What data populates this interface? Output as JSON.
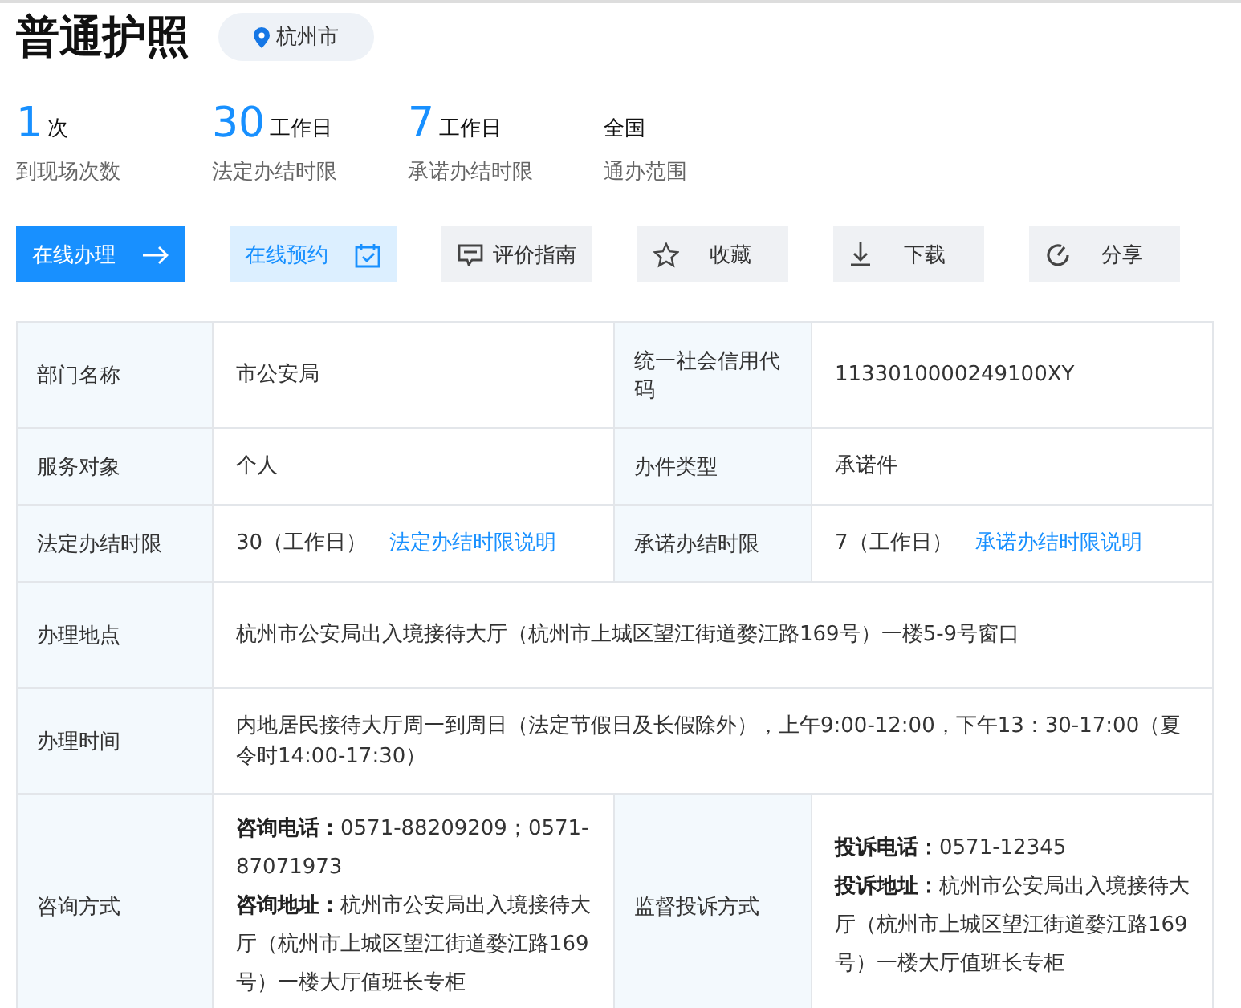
{
  "title": "普通护照",
  "location": "杭州市",
  "stats": [
    {
      "value": "1",
      "unit": "次",
      "label": "到现场次数"
    },
    {
      "value": "30",
      "unit": "工作日",
      "label": "法定办结时限"
    },
    {
      "value": "7",
      "unit": "工作日",
      "label": "承诺办结时限"
    },
    {
      "unit": "全国",
      "label": "通办范围"
    }
  ],
  "actions": [
    {
      "kind": "primary",
      "label": "在线办理"
    },
    {
      "kind": "light",
      "label": "在线预约"
    },
    {
      "kind": "gray",
      "label": "评价指南"
    },
    {
      "kind": "gray",
      "label": "收藏"
    },
    {
      "kind": "gray",
      "label": "下载"
    },
    {
      "kind": "gray",
      "label": "分享"
    }
  ],
  "rows": [
    {
      "cells": [
        {
          "label": "部门名称",
          "value": "市公安局"
        },
        {
          "label": "统一社会信用代码",
          "value": "1133010000249100XY"
        }
      ]
    },
    {
      "cells": [
        {
          "label": "服务对象",
          "value": "个人"
        },
        {
          "label": "办件类型",
          "value": "承诺件"
        }
      ]
    },
    {
      "cells": [
        {
          "label": "法定办结时限",
          "value": "30（工作日）",
          "link": "法定办结时限说明"
        },
        {
          "label": "承诺办结时限",
          "value": "7（工作日）",
          "link": "承诺办结时限说明"
        }
      ]
    },
    {
      "cells": [
        {
          "label": "办理地点",
          "value": "杭州市公安局出入境接待大厅（杭州市上城区望江街道婺江路169号）一楼5-9号窗口"
        }
      ]
    },
    {
      "cells": [
        {
          "label": "办理时间",
          "value": "内地居民接待大厅周一到周日（法定节假日及长假除外），上午9:00-12:00，下午13：30-17:00（夏令时14:00-17:30）"
        }
      ]
    },
    {
      "cells": [
        {
          "label": "咨询方式",
          "lines": [
            {
              "key": "咨询电话：",
              "text": "0571-88209209；0571-87071973"
            },
            {
              "key": "咨询地址：",
              "text": "杭州市公安局出入境接待大厅（杭州市上城区望江街道婺江路169号）一楼大厅值班长专柜"
            }
          ]
        },
        {
          "label": "监督投诉方式",
          "lines": [
            {
              "key": "投诉电话：",
              "text": "0571-12345"
            },
            {
              "key": "投诉地址：",
              "text": "杭州市公安局出入境接待大厅（杭州市上城区望江街道婺江路169号）一楼大厅值班长专柜"
            }
          ]
        }
      ]
    }
  ]
}
